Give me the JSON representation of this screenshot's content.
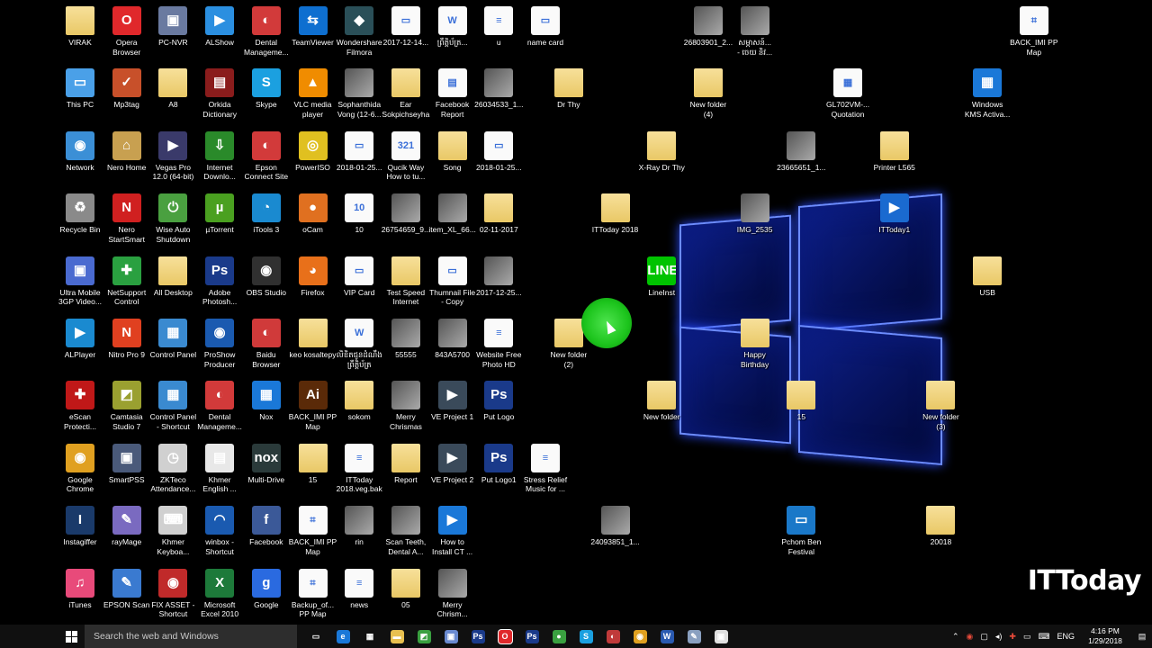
{
  "desktop": {
    "watermark": "ITToday",
    "icons": [
      {
        "label": "VIRAK",
        "icon": "user-folder-icon",
        "kind": "folder"
      },
      {
        "label": "Opera\nBrowser",
        "icon": "opera-icon",
        "kind": "app",
        "color": "#e0282b",
        "glyph": "O"
      },
      {
        "label": "PC-NVR",
        "icon": "pc-nvr-icon",
        "kind": "app",
        "color": "#6a7aa0",
        "glyph": "▣"
      },
      {
        "label": "ALShow",
        "icon": "alshow-icon",
        "kind": "app",
        "color": "#2b8fe0",
        "glyph": "▶"
      },
      {
        "label": "Dental\nManageme...",
        "icon": "dental-icon",
        "kind": "app",
        "color": "#d23a3a",
        "glyph": "◐"
      },
      {
        "label": "TeamViewer",
        "icon": "teamviewer-icon",
        "kind": "app",
        "color": "#0e6fd0",
        "glyph": "⇆"
      },
      {
        "label": "Wondershare\nFilmora",
        "icon": "filmora-icon",
        "kind": "app",
        "color": "#2a4f58",
        "glyph": "◆"
      },
      {
        "label": "2017-12-14...",
        "icon": "image-file-icon",
        "kind": "doc",
        "glyph": "▭"
      },
      {
        "label": "ព្រឹត្តិប័ត្រ...",
        "icon": "word-doc-icon",
        "kind": "doc",
        "glyph": "W"
      },
      {
        "label": "u",
        "icon": "text-file-icon",
        "kind": "doc",
        "glyph": "≡"
      },
      {
        "label": "name card",
        "icon": "image-file-icon",
        "kind": "doc",
        "glyph": "▭"
      },
      {
        "label": "26803901_2...",
        "icon": "photo-icon",
        "kind": "img"
      },
      {
        "label": "សម្ភាសន៍...\n- ចេយ និវ...",
        "icon": "video-thumb-icon",
        "kind": "img"
      },
      {
        "label": "BACK_IMI PP\nMap",
        "icon": "map-file-icon",
        "kind": "doc",
        "glyph": "⌗"
      },
      {
        "label": "This PC",
        "icon": "this-pc-icon",
        "kind": "app",
        "color": "#4aa0e8",
        "glyph": "▭"
      },
      {
        "label": "Mp3tag",
        "icon": "mp3tag-icon",
        "kind": "app",
        "color": "#c8502a",
        "glyph": "✓"
      },
      {
        "label": "A8",
        "icon": "folder-icon",
        "kind": "folder"
      },
      {
        "label": "Orkida\nDictionary",
        "icon": "dictionary-icon",
        "kind": "app",
        "color": "#8a1c1c",
        "glyph": "▤"
      },
      {
        "label": "Skype",
        "icon": "skype-icon",
        "kind": "app",
        "color": "#1ba0e0",
        "glyph": "S"
      },
      {
        "label": "VLC media\nplayer",
        "icon": "vlc-icon",
        "kind": "app",
        "color": "#f08c00",
        "glyph": "▲"
      },
      {
        "label": "Sophanthida\nVong (12-6...",
        "icon": "xray-image-icon",
        "kind": "img"
      },
      {
        "label": "Ear\nSokpichseyha",
        "icon": "folder-icon",
        "kind": "folder"
      },
      {
        "label": "Facebook\nReport",
        "icon": "pdf-icon",
        "kind": "doc",
        "glyph": "▤"
      },
      {
        "label": "26034533_1...",
        "icon": "photo-icon",
        "kind": "img"
      },
      {
        "label": "Dr Thy",
        "icon": "folder-icon",
        "kind": "folder"
      },
      {
        "label": "New folder\n(4)",
        "icon": "folder-icon",
        "kind": "folder"
      },
      {
        "label": "GL702VM-...\nQuotation",
        "icon": "spreadsheet-icon",
        "kind": "doc",
        "glyph": "▦"
      },
      {
        "label": "Windows\nKMS Activa...",
        "icon": "windows-app-icon",
        "kind": "app",
        "color": "#1a78d8",
        "glyph": "▦"
      },
      {
        "label": "Network",
        "icon": "network-icon",
        "kind": "app",
        "color": "#3b8fd6",
        "glyph": "◉"
      },
      {
        "label": "Nero Home",
        "icon": "nero-home-icon",
        "kind": "app",
        "color": "#c8a050",
        "glyph": "⌂"
      },
      {
        "label": "Vegas Pro\n12.0 (64-bit)",
        "icon": "vegas-icon",
        "kind": "app",
        "color": "#3a3a6a",
        "glyph": "▶"
      },
      {
        "label": "Internet\nDownlo...",
        "icon": "idm-icon",
        "kind": "app",
        "color": "#2a8a2a",
        "glyph": "⇩"
      },
      {
        "label": "Epson\nConnect Site",
        "icon": "epson-icon",
        "kind": "app",
        "color": "#d23a3a",
        "glyph": "◐"
      },
      {
        "label": "PowerISO",
        "icon": "poweriso-icon",
        "kind": "app",
        "color": "#e0c020",
        "glyph": "◎"
      },
      {
        "label": "2018-01-25...",
        "icon": "image-file-icon",
        "kind": "doc",
        "glyph": "▭"
      },
      {
        "label": "Qucik Way\nHow to tu...",
        "icon": "video-file-icon",
        "kind": "doc",
        "glyph": "321"
      },
      {
        "label": "Song",
        "icon": "folder-icon",
        "kind": "folder"
      },
      {
        "label": "2018-01-25...",
        "icon": "image-file-icon",
        "kind": "doc",
        "glyph": "▭"
      },
      {
        "label": "X-Ray Dr Thy",
        "icon": "folder-icon",
        "kind": "folder"
      },
      {
        "label": "23665651_1...",
        "icon": "photo-icon",
        "kind": "img"
      },
      {
        "label": "Printer L565",
        "icon": "folder-icon",
        "kind": "folder"
      },
      {
        "label": "Recycle Bin",
        "icon": "recycle-bin-icon",
        "kind": "app",
        "color": "#8a8a8a",
        "glyph": "♻"
      },
      {
        "label": "Nero\nStartSmart",
        "icon": "nero-icon",
        "kind": "app",
        "color": "#d02020",
        "glyph": "N"
      },
      {
        "label": "Wise Auto\nShutdown",
        "icon": "wise-icon",
        "kind": "app",
        "color": "#4aa040",
        "glyph": "⏻"
      },
      {
        "label": "µTorrent",
        "icon": "utorrent-icon",
        "kind": "app",
        "color": "#4aa020",
        "glyph": "µ"
      },
      {
        "label": "iTools 3",
        "icon": "itools-icon",
        "kind": "app",
        "color": "#1a8ad0",
        "glyph": "◔"
      },
      {
        "label": "oCam",
        "icon": "ocam-icon",
        "kind": "app",
        "color": "#e07020",
        "glyph": "●"
      },
      {
        "label": "10",
        "icon": "image-file-icon",
        "kind": "doc",
        "glyph": "10"
      },
      {
        "label": "26754659_9...",
        "icon": "photo-icon",
        "kind": "img"
      },
      {
        "label": "item_XL_66...",
        "icon": "photo-icon",
        "kind": "img"
      },
      {
        "label": "02-11-2017",
        "icon": "folder-icon",
        "kind": "folder"
      },
      {
        "label": "ITToday 2018",
        "icon": "folder-icon",
        "kind": "folder"
      },
      {
        "label": "IMG_2535",
        "icon": "photo-icon",
        "kind": "img"
      },
      {
        "label": "ITToday1",
        "icon": "video-file-icon",
        "kind": "app",
        "color": "#1a6ad0",
        "glyph": "▶"
      },
      {
        "label": "Ultra Mobile\n3GP Video...",
        "icon": "ultra-mobile-icon",
        "kind": "app",
        "color": "#4a6ad0",
        "glyph": "▣"
      },
      {
        "label": "NetSupport\nControl",
        "icon": "netsupport-icon",
        "kind": "app",
        "color": "#2aa040",
        "glyph": "✚"
      },
      {
        "label": "All Desktop",
        "icon": "folder-icon",
        "kind": "folder"
      },
      {
        "label": "Adobe\nPhotosh...",
        "icon": "photoshop-icon",
        "kind": "app",
        "color": "#1a3a8a",
        "glyph": "Ps"
      },
      {
        "label": "OBS Studio",
        "icon": "obs-icon",
        "kind": "app",
        "color": "#303030",
        "glyph": "◉"
      },
      {
        "label": "Firefox",
        "icon": "firefox-icon",
        "kind": "app",
        "color": "#e8701a",
        "glyph": "◕"
      },
      {
        "label": "VIP Card",
        "icon": "image-file-icon",
        "kind": "doc",
        "glyph": "▭"
      },
      {
        "label": "Test Speed\nInternet",
        "icon": "folder-icon",
        "kind": "folder"
      },
      {
        "label": "Thumnail File\n- Copy",
        "icon": "image-file-icon",
        "kind": "doc",
        "glyph": "▭"
      },
      {
        "label": "2017-12-25...",
        "icon": "photo-icon",
        "kind": "img"
      },
      {
        "label": "LineInst",
        "icon": "line-icon",
        "kind": "app",
        "color": "#00c300",
        "glyph": "LINE"
      },
      {
        "label": "USB",
        "icon": "folder-icon",
        "kind": "folder"
      },
      {
        "label": "ALPlayer",
        "icon": "alplayer-icon",
        "kind": "app",
        "color": "#1a8ad0",
        "glyph": "▶"
      },
      {
        "label": "Nitro Pro 9",
        "icon": "nitro-icon",
        "kind": "app",
        "color": "#e04020",
        "glyph": "N"
      },
      {
        "label": "Control Panel",
        "icon": "control-panel-icon",
        "kind": "app",
        "color": "#3a8ad0",
        "glyph": "▦"
      },
      {
        "label": "ProShow\nProducer",
        "icon": "proshow-icon",
        "kind": "app",
        "color": "#1a5ab0",
        "glyph": "◉"
      },
      {
        "label": "Baidu\nBrowser",
        "icon": "baidu-icon",
        "kind": "app",
        "color": "#d03a3a",
        "glyph": "◐"
      },
      {
        "label": "keo kosaltepy",
        "icon": "folder-icon",
        "kind": "folder"
      },
      {
        "label": "លិខិតជូនដំណឹង\nព្រឹត្តិប័ត្រ",
        "icon": "word-doc-icon",
        "kind": "doc",
        "glyph": "W"
      },
      {
        "label": "55555",
        "icon": "video-thumb-icon",
        "kind": "img"
      },
      {
        "label": "843A5700",
        "icon": "photo-icon",
        "kind": "img"
      },
      {
        "label": "Website Free\nPhoto HD",
        "icon": "text-file-icon",
        "kind": "doc",
        "glyph": "≡"
      },
      {
        "label": "New folder\n(2)",
        "icon": "folder-icon",
        "kind": "folder"
      },
      {
        "label": "Happy\nBirthday",
        "icon": "folder-icon",
        "kind": "folder"
      },
      {
        "label": "eScan\nProtecti...",
        "icon": "escan-icon",
        "kind": "app",
        "color": "#c01818",
        "glyph": "✚"
      },
      {
        "label": "Camtasia\nStudio 7",
        "icon": "camtasia-icon",
        "kind": "app",
        "color": "#9aa030",
        "glyph": "◩"
      },
      {
        "label": "Control Panel\n- Shortcut",
        "icon": "control-panel-icon",
        "kind": "app",
        "color": "#3a8ad0",
        "glyph": "▦"
      },
      {
        "label": "Dental\nManageme...",
        "icon": "dental-icon",
        "kind": "app",
        "color": "#d23a3a",
        "glyph": "◐"
      },
      {
        "label": "Nox",
        "icon": "nox-icon",
        "kind": "app",
        "color": "#1a78d8",
        "glyph": "▦"
      },
      {
        "label": "BACK_IMI PP\nMap",
        "icon": "illustrator-icon",
        "kind": "app",
        "color": "#5a2a08",
        "glyph": "Ai"
      },
      {
        "label": "sokom",
        "icon": "folder-icon",
        "kind": "folder"
      },
      {
        "label": "Merry\nChrismas",
        "icon": "image-file-icon",
        "kind": "img"
      },
      {
        "label": "VE Project 1",
        "icon": "ve-project-icon",
        "kind": "app",
        "color": "#3a4a5a",
        "glyph": "▶"
      },
      {
        "label": "Put Logo",
        "icon": "psd-file-icon",
        "kind": "app",
        "color": "#1a3a8a",
        "glyph": "Ps"
      },
      {
        "label": "New folder",
        "icon": "folder-icon",
        "kind": "folder"
      },
      {
        "label": "15",
        "icon": "folder-icon",
        "kind": "folder"
      },
      {
        "label": "New folder\n(3)",
        "icon": "folder-icon",
        "kind": "folder"
      },
      {
        "label": "Google\nChrome",
        "icon": "chrome-icon",
        "kind": "app",
        "color": "#e0a020",
        "glyph": "◉"
      },
      {
        "label": "SmartPSS",
        "icon": "smartpss-icon",
        "kind": "app",
        "color": "#4a5a7a",
        "glyph": "▣"
      },
      {
        "label": "ZKTeco\nAttendance...",
        "icon": "zkteco-icon",
        "kind": "app",
        "color": "#d0d0d0",
        "glyph": "◷"
      },
      {
        "label": "Khmer\nEnglish ...",
        "icon": "dictionary-icon",
        "kind": "app",
        "color": "#e8e8e8",
        "glyph": "▤"
      },
      {
        "label": "Multi-Drive",
        "icon": "nox-multidrive-icon",
        "kind": "app",
        "color": "#2a3a3a",
        "glyph": "nox"
      },
      {
        "label": "15",
        "icon": "folder-icon",
        "kind": "folder"
      },
      {
        "label": "ITToday\n2018.veg.bak",
        "icon": "text-file-icon",
        "kind": "doc",
        "glyph": "≡"
      },
      {
        "label": "Report",
        "icon": "folder-icon",
        "kind": "folder"
      },
      {
        "label": "VE Project 2",
        "icon": "ve-project-icon",
        "kind": "app",
        "color": "#3a4a5a",
        "glyph": "▶"
      },
      {
        "label": "Put Logo1",
        "icon": "psd-file-icon",
        "kind": "app",
        "color": "#1a3a8a",
        "glyph": "Ps"
      },
      {
        "label": "Stress Relief\nMusic for ...",
        "icon": "text-file-icon",
        "kind": "doc",
        "glyph": "≡"
      },
      {
        "label": "Instagiffer",
        "icon": "instagiffer-icon",
        "kind": "app",
        "color": "#1a3a6a",
        "glyph": "I"
      },
      {
        "label": "rayMage",
        "icon": "raymage-icon",
        "kind": "app",
        "color": "#7a6ac0",
        "glyph": "✎"
      },
      {
        "label": "Khmer\nKeyboa...",
        "icon": "keyboard-icon",
        "kind": "app",
        "color": "#d0d0d0",
        "glyph": "⌨"
      },
      {
        "label": "winbox -\nShortcut",
        "icon": "winbox-icon",
        "kind": "app",
        "color": "#1a5ab0",
        "glyph": "◠"
      },
      {
        "label": "Facebook",
        "icon": "facebook-icon",
        "kind": "app",
        "color": "#3b5998",
        "glyph": "f"
      },
      {
        "label": "BACK_IMI PP\nMap",
        "icon": "map-file-icon",
        "kind": "doc",
        "glyph": "⌗"
      },
      {
        "label": "rin",
        "icon": "image-file-icon",
        "kind": "img"
      },
      {
        "label": "Scan Teeth,\nDental A...",
        "icon": "video-thumb-icon",
        "kind": "img"
      },
      {
        "label": "How to\nInstall CT ...",
        "icon": "video-thumb-icon",
        "kind": "app",
        "color": "#1a78d8",
        "glyph": "▶"
      },
      {
        "label": "24093851_1...",
        "icon": "photo-icon",
        "kind": "img"
      },
      {
        "label": "Pchom Ben\nFestival",
        "icon": "image-file-icon",
        "kind": "app",
        "color": "#1a78c8",
        "glyph": "▭"
      },
      {
        "label": "20018",
        "icon": "folder-icon",
        "kind": "folder"
      },
      {
        "label": "iTunes",
        "icon": "itunes-icon",
        "kind": "app",
        "color": "#e84a7a",
        "glyph": "♫"
      },
      {
        "label": "EPSON Scan",
        "icon": "epson-scan-icon",
        "kind": "app",
        "color": "#3a7ad0",
        "glyph": "✎"
      },
      {
        "label": "FIX ASSET -\nShortcut",
        "icon": "fix-asset-icon",
        "kind": "app",
        "color": "#c02a2a",
        "glyph": "◉"
      },
      {
        "label": "Microsoft\nExcel 2010",
        "icon": "excel-icon",
        "kind": "app",
        "color": "#1d7a3a",
        "glyph": "X"
      },
      {
        "label": "Google",
        "icon": "google-icon",
        "kind": "app",
        "color": "#2a6ae0",
        "glyph": "g"
      },
      {
        "label": "Backup_of...\nPP Map",
        "icon": "map-file-icon",
        "kind": "doc",
        "glyph": "⌗"
      },
      {
        "label": "news",
        "icon": "text-file-icon",
        "kind": "doc",
        "glyph": "≡"
      },
      {
        "label": "05",
        "icon": "folder-icon",
        "kind": "folder"
      },
      {
        "label": "Merry\nChrism...",
        "icon": "image-file-icon",
        "kind": "img"
      }
    ]
  },
  "taskbar": {
    "search_placeholder": "Search the web and Windows",
    "pinned": [
      {
        "icon": "task-view-icon",
        "color": "#101010",
        "glyph": "▭"
      },
      {
        "icon": "edge-icon",
        "color": "#1a78d8",
        "glyph": "e"
      },
      {
        "icon": "store-icon",
        "color": "#101010",
        "glyph": "▦"
      },
      {
        "icon": "file-explorer-icon",
        "color": "#e8c050",
        "glyph": "▬"
      },
      {
        "icon": "camtasia-taskbar-icon",
        "color": "#3aa040",
        "glyph": "◩"
      },
      {
        "icon": "app-window-icon",
        "color": "#6a8ad0",
        "glyph": "▣"
      },
      {
        "icon": "photoshop-taskbar-icon",
        "color": "#1a3a8a",
        "glyph": "Ps"
      },
      {
        "icon": "opera-taskbar-icon",
        "color": "#e0282b",
        "glyph": "O",
        "active": true
      },
      {
        "icon": "photoshop-taskbar-icon-2",
        "color": "#1a3a8a",
        "glyph": "Ps"
      },
      {
        "icon": "camtasia-recorder-icon",
        "color": "#3aa040",
        "glyph": "●"
      },
      {
        "icon": "skype-taskbar-icon",
        "color": "#1ba0e0",
        "glyph": "S"
      },
      {
        "icon": "baidu-taskbar-icon",
        "color": "#c03a3a",
        "glyph": "◐"
      },
      {
        "icon": "chrome-taskbar-icon",
        "color": "#e0a020",
        "glyph": "◉"
      },
      {
        "icon": "word-taskbar-icon",
        "color": "#2a5ab0",
        "glyph": "W"
      },
      {
        "icon": "notepad-taskbar-icon",
        "color": "#8aa0c0",
        "glyph": "✎"
      },
      {
        "icon": "screenshot-taskbar-icon",
        "color": "#e0e0e0",
        "glyph": "▣"
      }
    ],
    "tray": {
      "lang": "ENG",
      "time": "4:16 PM",
      "date": "1/29/2018"
    }
  },
  "colors": {
    "desktop_bg": "#000000",
    "taskbar_bg": "#101010",
    "logo_glow": "#6c8cff",
    "cursor_highlight": "#1cc41c"
  }
}
